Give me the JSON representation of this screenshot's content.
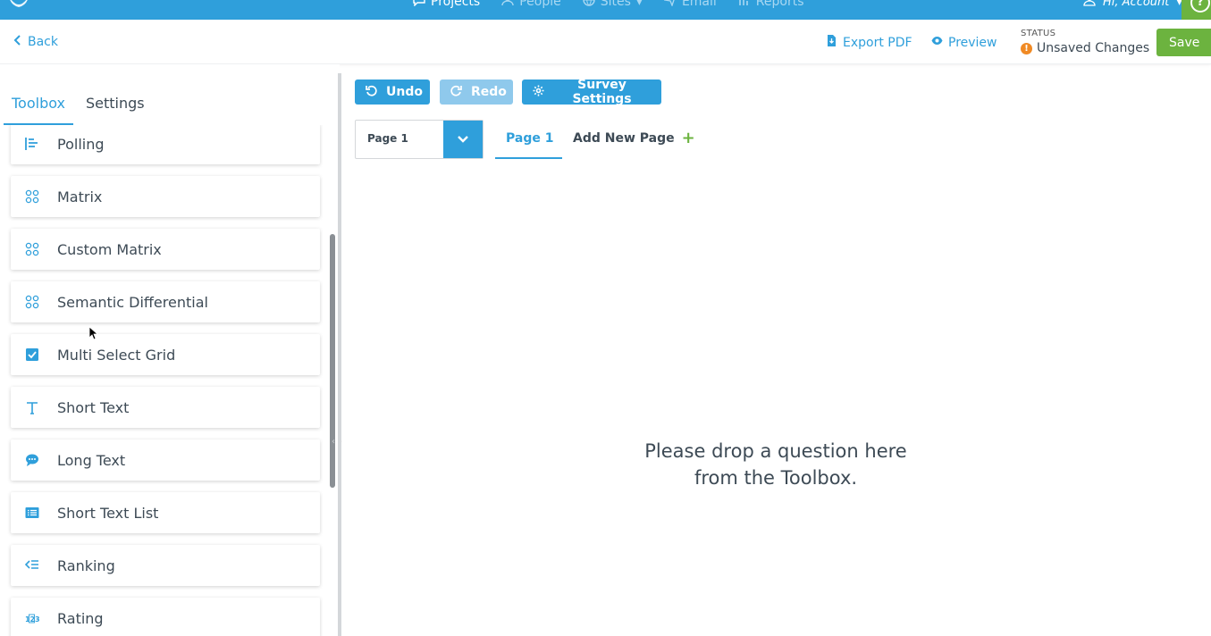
{
  "topnav": {
    "links": [
      {
        "label": "Projects",
        "icon": "chat-icon",
        "active": true
      },
      {
        "label": "People",
        "icon": "person-icon",
        "active": false
      },
      {
        "label": "Sites",
        "icon": "globe-icon",
        "active": false
      },
      {
        "label": "Email",
        "icon": "send-icon",
        "active": false
      },
      {
        "label": "Reports",
        "icon": "chart-icon",
        "active": false
      }
    ],
    "account_label": "Hi, Account",
    "help_label": "?"
  },
  "actionbar": {
    "back_label": "Back",
    "export_label": "Export PDF",
    "preview_label": "Preview",
    "status_label": "STATUS",
    "status_value": "Unsaved Changes",
    "save_label": "Save"
  },
  "leftpanel": {
    "tabs": [
      {
        "label": "Toolbox",
        "active": true
      },
      {
        "label": "Settings",
        "active": false
      }
    ],
    "items": [
      {
        "label": "Polling",
        "icon": "polling-bars-icon"
      },
      {
        "label": "Matrix",
        "icon": "matrix-grid-icon"
      },
      {
        "label": "Custom Matrix",
        "icon": "matrix-grid-icon"
      },
      {
        "label": "Semantic Differential",
        "icon": "matrix-grid-icon"
      },
      {
        "label": "Multi Select Grid",
        "icon": "checkbox-icon"
      },
      {
        "label": "Short Text",
        "icon": "text-t-icon"
      },
      {
        "label": "Long Text",
        "icon": "speech-bubble-icon"
      },
      {
        "label": "Short Text List",
        "icon": "list-icon"
      },
      {
        "label": "Ranking",
        "icon": "ranking-icon"
      },
      {
        "label": "Rating",
        "icon": "rating-123-icon"
      }
    ]
  },
  "main": {
    "undo_label": "Undo",
    "redo_label": "Redo",
    "survey_settings_label": "Survey Settings",
    "page_select_value": "Page 1",
    "page_tab_label": "Page 1",
    "add_page_label": "Add New Page",
    "drop_line1": "Please drop a question here",
    "drop_line2": "from the Toolbox."
  },
  "colors": {
    "brand_blue": "#2f9fdb",
    "save_green": "#6cb33f",
    "warning_orange": "#f08a24"
  }
}
